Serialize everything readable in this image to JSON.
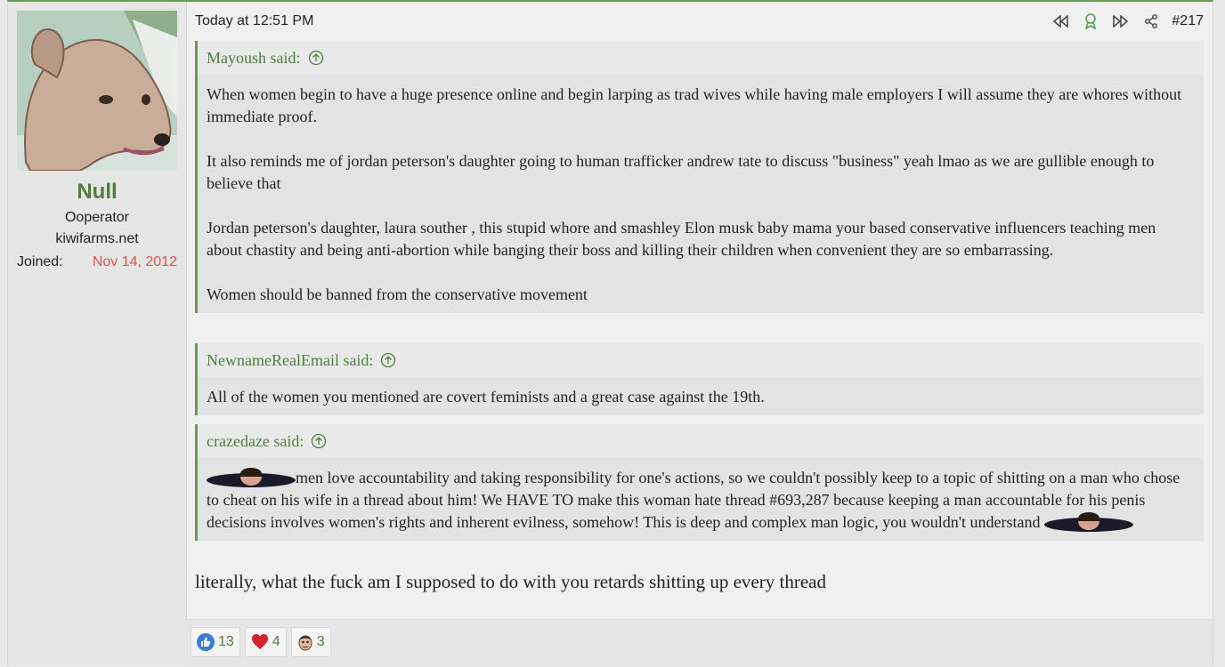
{
  "user": {
    "name": "Null",
    "title": "Ooperator",
    "site": "kiwifarms.net",
    "joined_label": "Joined:",
    "joined_date": "Nov 14, 2012"
  },
  "post": {
    "timestamp": "Today at 12:51 PM",
    "number": "#217",
    "body": "literally, what the fuck am I supposed to do with you retards shitting up every thread"
  },
  "quotes": [
    {
      "author": "Mayoush said:",
      "paragraphs": [
        "When women begin to have a huge presence online and begin larping as trad wives while having male employers I will assume they are whores without immediate proof.",
        "It also reminds me of jordan peterson's daughter going to human trafficker andrew tate to discuss \"business\" yeah lmao as we are gullible enough to believe that",
        "Jordan peterson's daughter, laura souther , this stupid whore and smashley Elon musk baby mama your based conservative influencers teaching men about chastity and being anti-abortion while banging their boss and killing their children when convenient they are so embarrassing.",
        "Women should be banned from the conservative movement"
      ]
    },
    {
      "author": "NewnameRealEmail said:",
      "paragraphs": [
        "All of the women you mentioned are covert feminists and a great case against the 19th."
      ]
    },
    {
      "author": "crazedaze said:",
      "text_before": "men love accountability and taking responsibility for one's actions, so we couldn't possibly keep to a topic of shitting on a man who chose to cheat on his wife in a thread about him! We HAVE TO make this woman hate thread #693,287 because keeping a man accountable for his penis decisions involves women's rights and inherent evilness, somehow! This is deep and complex man logic, you wouldn't understand"
    }
  ],
  "reactions": [
    {
      "icon": "thumbs-up-icon",
      "count": "13"
    },
    {
      "icon": "heart-icon",
      "count": "4"
    },
    {
      "icon": "face-icon",
      "count": "3"
    }
  ],
  "colors": {
    "accent": "#4f7d3d",
    "joined_date": "#d9534f",
    "quote_border": "#6a9a5a"
  }
}
